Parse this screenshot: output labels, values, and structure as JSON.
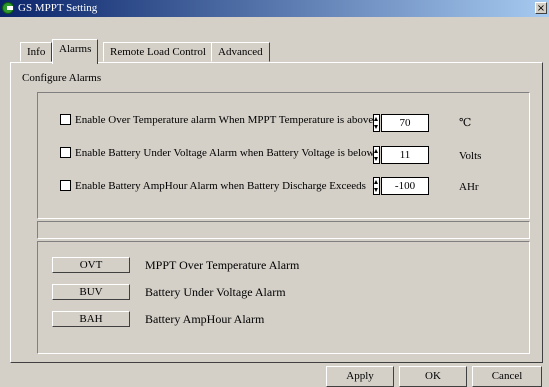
{
  "window": {
    "title": "GS MPPT Setting",
    "close_glyph": "×"
  },
  "tabs": [
    {
      "label": "Info"
    },
    {
      "label": "Alarms"
    },
    {
      "label": "Remote Load Control"
    },
    {
      "label": "Advanced"
    }
  ],
  "active_tab": "Alarms",
  "group_title": "Configure Alarms",
  "alarms": [
    {
      "checked": false,
      "label": "Enable Over Temperature alarm When MPPT Temperature is above",
      "value": "70",
      "unit": "℃"
    },
    {
      "checked": false,
      "label": "Enable Battery Under Voltage Alarm when Battery Voltage is below",
      "value": "11",
      "unit": "Volts"
    },
    {
      "checked": false,
      "label": "Enable Battery AmpHour Alarm when Battery Discharge Exceeds",
      "value": "-100",
      "unit": "AHr"
    }
  ],
  "legend": [
    {
      "code": "OVT",
      "text": "MPPT Over Temperature Alarm"
    },
    {
      "code": "BUV",
      "text": "Battery Under Voltage Alarm"
    },
    {
      "code": "BAH",
      "text": "Battery AmpHour Alarm"
    }
  ],
  "buttons": {
    "apply": "Apply",
    "ok": "OK",
    "cancel": "Cancel"
  },
  "colors": {
    "title_bar": "#0a246a",
    "face": "#d4d0c8"
  },
  "icons": [
    "app-logo-icon",
    "close-icon",
    "checkbox-icon",
    "spinner-arrows-icon"
  ]
}
